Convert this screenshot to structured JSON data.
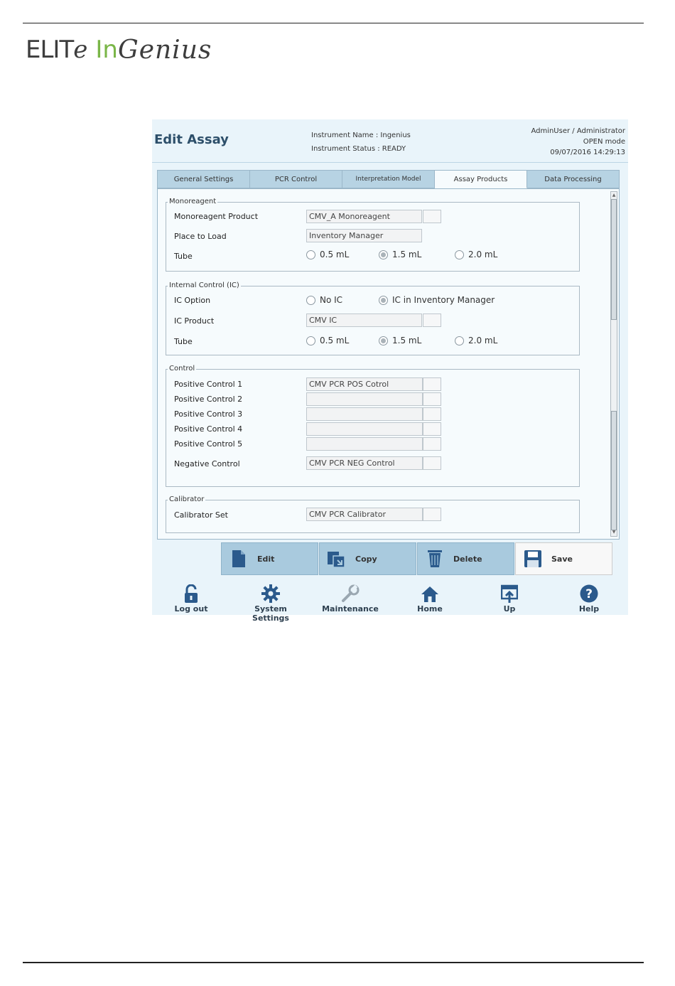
{
  "logo": {
    "elite": "ELIT",
    "elite_e": "e",
    "in": "In",
    "genius": "Genius"
  },
  "header": {
    "title": "Edit Assay",
    "instrument_name": "Instrument Name :  Ingenius",
    "instrument_status": "Instrument Status : READY",
    "user": "AdminUser / Administrator",
    "mode": "OPEN mode",
    "datetime": "09/07/2016 14:29:13"
  },
  "tabs": [
    {
      "label": "General Settings"
    },
    {
      "label": "PCR Control"
    },
    {
      "label": "Interpretation Model"
    },
    {
      "label": "Assay Products"
    },
    {
      "label": "Data Processing"
    }
  ],
  "monoreagent": {
    "group": "Monoreagent",
    "product_label": "Monoreagent Product",
    "product_value": "CMV_A Monoreagent",
    "place_label": "Place to Load",
    "place_value": "Inventory Manager",
    "tube_label": "Tube",
    "tube_options": [
      "0.5 mL",
      "1.5 mL",
      "2.0 mL"
    ],
    "tube_selected": "1.5 mL"
  },
  "internal_control": {
    "group": "Internal Control (IC)",
    "option_label": "IC Option",
    "options": [
      "No IC",
      "IC in Inventory Manager"
    ],
    "option_selected": "IC in Inventory Manager",
    "product_label": "IC Product",
    "product_value": "CMV IC",
    "tube_label": "Tube",
    "tube_options": [
      "0.5 mL",
      "1.5 mL",
      "2.0 mL"
    ],
    "tube_selected": "1.5 mL"
  },
  "control": {
    "group": "Control",
    "positive": [
      {
        "label": "Positive Control 1",
        "value": "CMV PCR POS Cotrol"
      },
      {
        "label": "Positive Control 2",
        "value": ""
      },
      {
        "label": "Positive Control 3",
        "value": ""
      },
      {
        "label": "Positive Control 4",
        "value": ""
      },
      {
        "label": "Positive Control 5",
        "value": ""
      }
    ],
    "negative_label": "Negative Control",
    "negative_value": "CMV PCR NEG Control"
  },
  "calibrator": {
    "group": "Calibrator",
    "set_label": "Calibrator Set",
    "set_value": "CMV PCR Calibrator"
  },
  "actions": {
    "edit": "Edit",
    "copy": "Copy",
    "delete": "Delete",
    "save": "Save"
  },
  "nav": {
    "logout": "Log out",
    "system_settings": "System Settings",
    "maintenance": "Maintenance",
    "home": "Home",
    "up": "Up",
    "help": "Help"
  },
  "colors": {
    "accent": "#2d4f6a",
    "panel": "#e9f4fa",
    "button": "#a9cade",
    "icon": "#2b5a8c",
    "logo_green": "#7ab648"
  }
}
